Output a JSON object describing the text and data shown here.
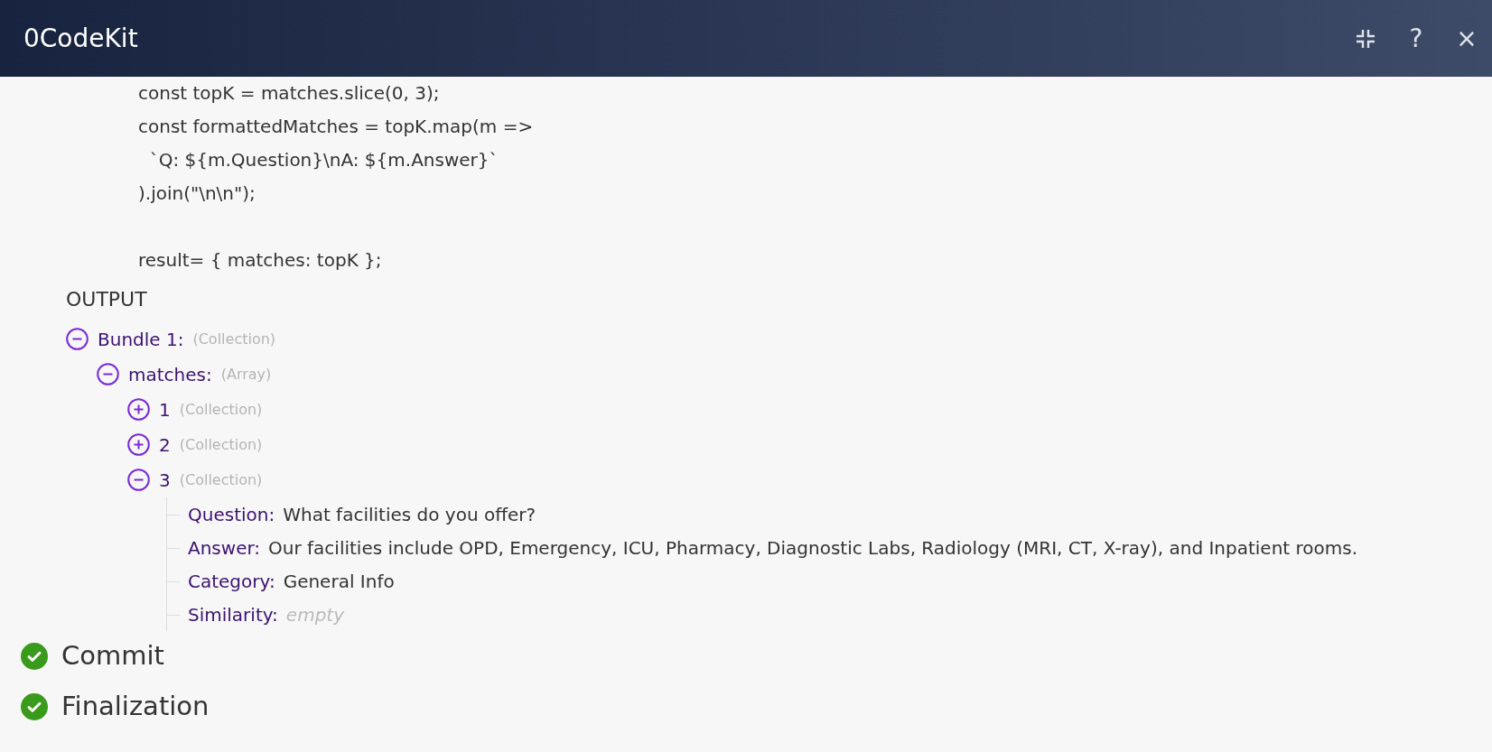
{
  "header": {
    "title": "0CodeKit",
    "buttons": [
      {
        "kind": "collapse"
      },
      {
        "kind": "help",
        "label": "?"
      },
      {
        "kind": "close",
        "label": "×"
      }
    ]
  },
  "code_blocks": [
    [
      "const topK = matches.slice(0, 3);",
      "const formattedMatches = topK.map(m =>",
      "  `Q: ${m.Question}\\nA: ${m.Answer}`",
      ").join(\"\\n\\n\");"
    ],
    [
      "result= { matches: topK };"
    ]
  ],
  "output": {
    "heading": "OUTPUT",
    "tree": [
      {
        "label": "Bundle 1:",
        "type": "(Collection)",
        "expanded": true,
        "children": [
          {
            "label": "matches:",
            "type": "(Array)",
            "expanded": true,
            "children": [
              {
                "label": "1",
                "type": "(Collection)",
                "expanded": false
              },
              {
                "label": "2",
                "type": "(Collection)",
                "expanded": false
              },
              {
                "label": "3",
                "type": "(Collection)",
                "expanded": true,
                "fields": [
                  {
                    "key": "Question:",
                    "value": "What facilities do you offer?",
                    "kind": "text"
                  },
                  {
                    "key": "Answer:",
                    "value": "Our facilities include OPD, Emergency, ICU, Pharmacy, Diagnostic Labs, Radiology (MRI, CT, X-ray), and Inpatient rooms.",
                    "kind": "text"
                  },
                  {
                    "key": "Category:",
                    "value": "General Info",
                    "kind": "text"
                  },
                  {
                    "key": "Similarity:",
                    "value": "empty",
                    "kind": "empty"
                  }
                ]
              }
            ]
          }
        ]
      }
    ]
  },
  "steps": [
    {
      "label": "Commit",
      "done": true
    },
    {
      "label": "Finalization",
      "done": true
    }
  ]
}
